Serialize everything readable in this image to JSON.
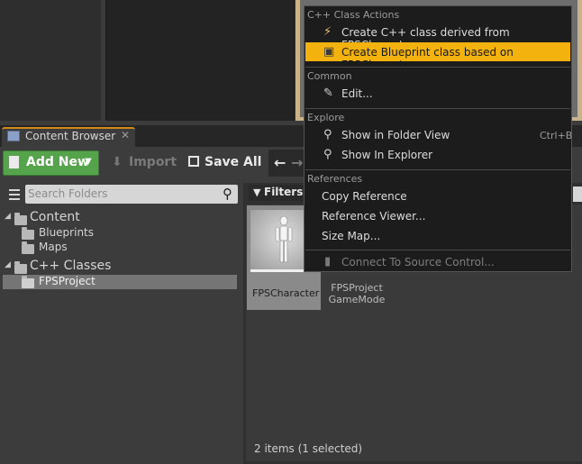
{
  "tab": {
    "title": "Content Browser",
    "close": "✕"
  },
  "toolbar": {
    "add_new": "Add New",
    "import": "Import",
    "save_all": "Save All"
  },
  "sidebar": {
    "search_placeholder": "Search Folders",
    "tree": [
      {
        "label": "Content"
      },
      {
        "label": "Blueprints"
      },
      {
        "label": "Maps"
      },
      {
        "label": "C++ Classes"
      },
      {
        "label": "FPSProject"
      }
    ]
  },
  "content": {
    "filters": "Filters",
    "assets": [
      {
        "name": "FPSCharacter"
      },
      {
        "name_line1": "FPSProject",
        "name_line2": "GameMode"
      }
    ],
    "status": "2 items (1 selected)"
  },
  "context_menu": {
    "sections": {
      "cpp_class_actions": "C++ Class Actions",
      "common": "Common",
      "explore": "Explore",
      "references": "References"
    },
    "items": {
      "create_cpp": "Create C++ class derived from FPSCharacter",
      "create_blueprint": "Create Blueprint class based on FPSCharacter",
      "edit": "Edit...",
      "show_folder_view": "Show in Folder View",
      "show_folder_view_shortcut": "Ctrl+B",
      "show_explorer": "Show In Explorer",
      "copy_reference": "Copy Reference",
      "reference_viewer": "Reference Viewer...",
      "size_map": "Size Map...",
      "connect_source_control": "Connect To Source Control..."
    }
  },
  "colors": {
    "accent_green": "#55a34b",
    "highlight_orange": "#f4b20e",
    "tab_accent": "#d08a18"
  }
}
